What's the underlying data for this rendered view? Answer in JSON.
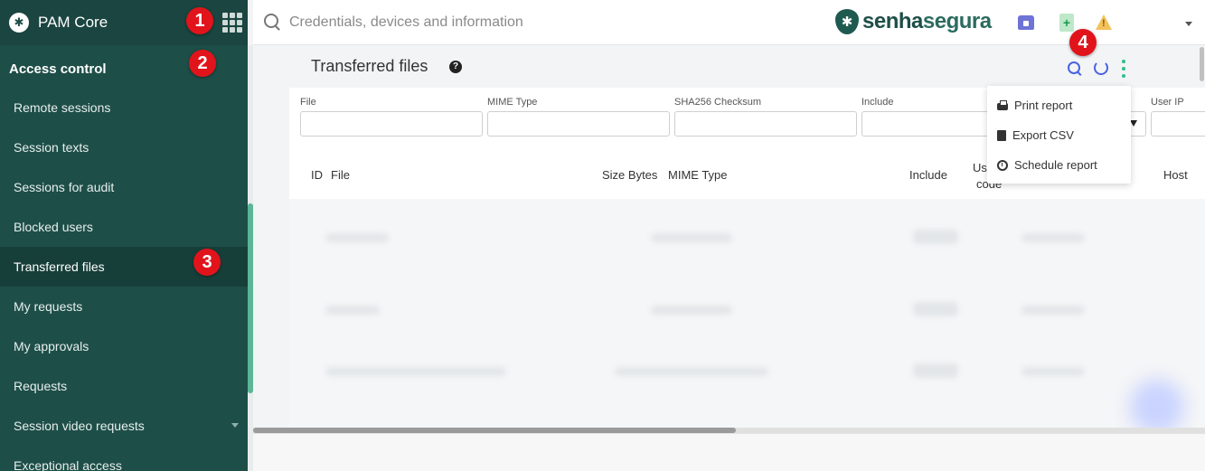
{
  "sidebar": {
    "brand": "PAM Core",
    "section_title": "Access control",
    "items": [
      {
        "label": "Remote sessions"
      },
      {
        "label": "Session texts"
      },
      {
        "label": "Sessions for audit"
      },
      {
        "label": "Blocked users"
      },
      {
        "label": "Transferred files",
        "active": true
      },
      {
        "label": "My requests"
      },
      {
        "label": "My approvals"
      },
      {
        "label": "Requests"
      },
      {
        "label": "Session video requests",
        "has_caret": true
      },
      {
        "label": "Exceptional access"
      }
    ]
  },
  "topbar": {
    "search_placeholder": "Credentials, devices and information",
    "logo_text_a": "senha",
    "logo_text_b": "segura",
    "icons": [
      "home-icon",
      "add-document-icon",
      "warning-icon",
      "user-menu-caret"
    ]
  },
  "page": {
    "title": "Transferred files",
    "help_glyph": "?"
  },
  "filters": [
    {
      "label": "File"
    },
    {
      "label": "MIME Type"
    },
    {
      "label": "SHA256 Checksum"
    },
    {
      "label": "Include"
    },
    {
      "label": "User IP"
    }
  ],
  "columns": [
    "ID",
    "File",
    "Size Bytes",
    "MIME Type",
    "Include",
    "Us",
    "code",
    "Host"
  ],
  "menu": {
    "items": [
      {
        "label": "Print report",
        "icon": "print-icon"
      },
      {
        "label": "Export CSV",
        "icon": "file-icon"
      },
      {
        "label": "Schedule report",
        "icon": "clock-icon"
      }
    ]
  },
  "callouts": [
    "1",
    "2",
    "3",
    "4"
  ],
  "colors": {
    "sidebar_bg": "#1e4e48",
    "accent_blue": "#4a63e0",
    "accent_green": "#2dbf86",
    "callout_red": "#e1141b"
  }
}
